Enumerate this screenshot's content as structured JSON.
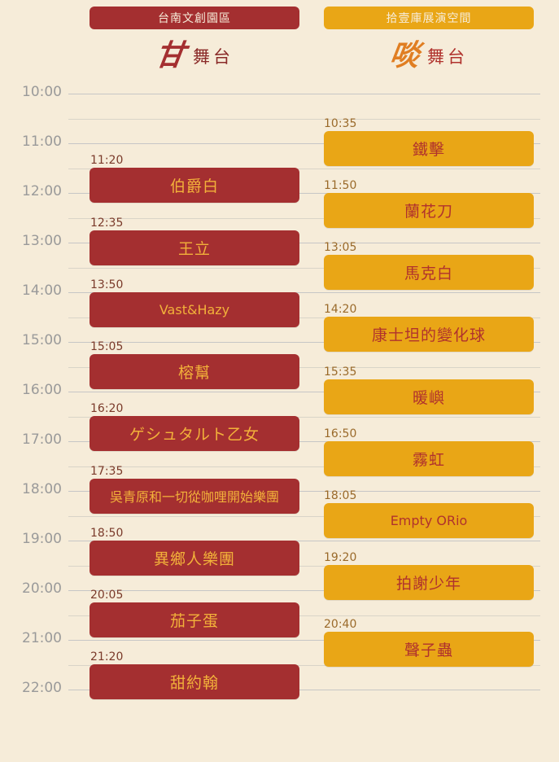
{
  "venues": {
    "left": {
      "name": "台南文創園區",
      "stage_logo": "甘",
      "stage_word": "舞台"
    },
    "right": {
      "name": "拾壹庫展演空間",
      "stage_logo": "啖",
      "stage_word": "舞台"
    }
  },
  "hours": [
    "10:00",
    "11:00",
    "12:00",
    "13:00",
    "14:00",
    "15:00",
    "16:00",
    "17:00",
    "18:00",
    "19:00",
    "20:00",
    "21:00",
    "22:00"
  ],
  "left_slots": [
    {
      "time": "11:20",
      "artist": "伯爵白"
    },
    {
      "time": "12:35",
      "artist": "王立"
    },
    {
      "time": "13:50",
      "artist": "Vast&Hazy"
    },
    {
      "time": "15:05",
      "artist": "榕幫"
    },
    {
      "time": "16:20",
      "artist": "ゲシュタルト乙女"
    },
    {
      "time": "17:35",
      "artist": "吳青原和一切從咖哩開始樂團"
    },
    {
      "time": "18:50",
      "artist": "異鄉人樂團"
    },
    {
      "time": "20:05",
      "artist": "茄子蛋"
    },
    {
      "time": "21:20",
      "artist": "甜約翰"
    }
  ],
  "right_slots": [
    {
      "time": "10:35",
      "artist": "鐵擊"
    },
    {
      "time": "11:50",
      "artist": "蘭花刀"
    },
    {
      "time": "13:05",
      "artist": "馬克白"
    },
    {
      "time": "14:20",
      "artist": "康士坦的變化球"
    },
    {
      "time": "15:35",
      "artist": "暖嶼"
    },
    {
      "time": "16:50",
      "artist": "霧虹"
    },
    {
      "time": "18:05",
      "artist": "Empty ORio"
    },
    {
      "time": "19:20",
      "artist": "拍謝少年"
    },
    {
      "time": "20:40",
      "artist": "聲子蟲"
    }
  ],
  "colors": {
    "background": "#f6ecd9",
    "left_stage": "#a42f30",
    "right_stage": "#e9a616"
  }
}
